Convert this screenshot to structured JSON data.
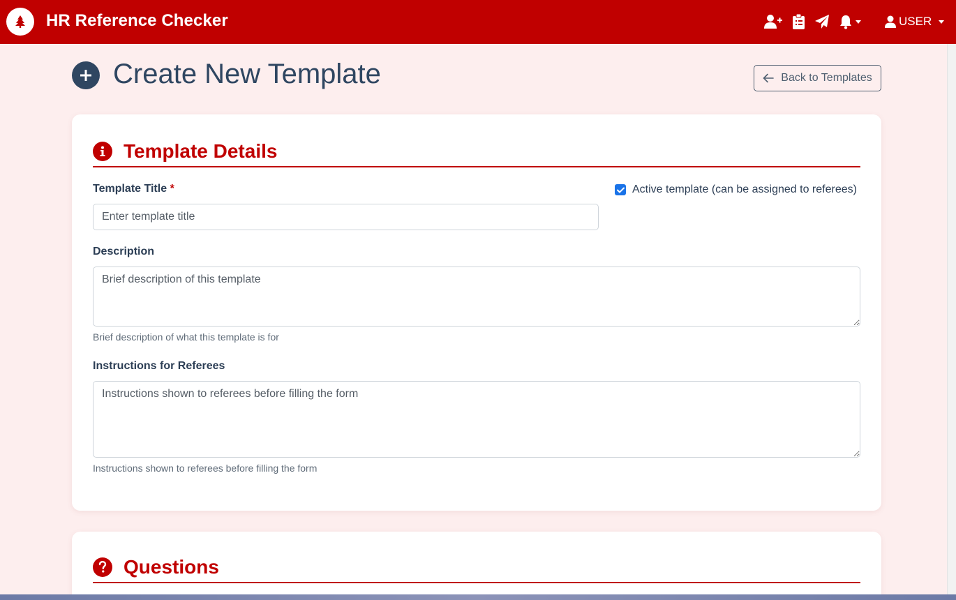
{
  "app": {
    "title": "HR Reference Checker",
    "brand_color": "#c00000",
    "logo_icon": "tree-icon"
  },
  "nav": {
    "icons": [
      "add-user-icon",
      "clipboard-icon",
      "paper-plane-icon",
      "bell-icon"
    ],
    "user_label": "USER"
  },
  "page": {
    "title": "Create New Template",
    "title_icon": "plus-circle-icon",
    "back_button_label": "Back to Templates"
  },
  "details": {
    "section_title": "Template Details",
    "section_icon": "info-circle-icon",
    "title_label": "Template Title",
    "title_required_mark": "*",
    "title_placeholder": "Enter template title",
    "title_value": "",
    "active_label": "Active template (can be assigned to referees)",
    "active_checked": true,
    "description_label": "Description",
    "description_placeholder": "Brief description of this template",
    "description_help": "Brief description of what this template is for",
    "instructions_label": "Instructions for Referees",
    "instructions_placeholder": "Instructions shown to referees before filling the form",
    "instructions_help": "Instructions shown to referees before filling the form"
  },
  "questions": {
    "section_title": "Questions",
    "section_icon": "question-circle-icon"
  }
}
